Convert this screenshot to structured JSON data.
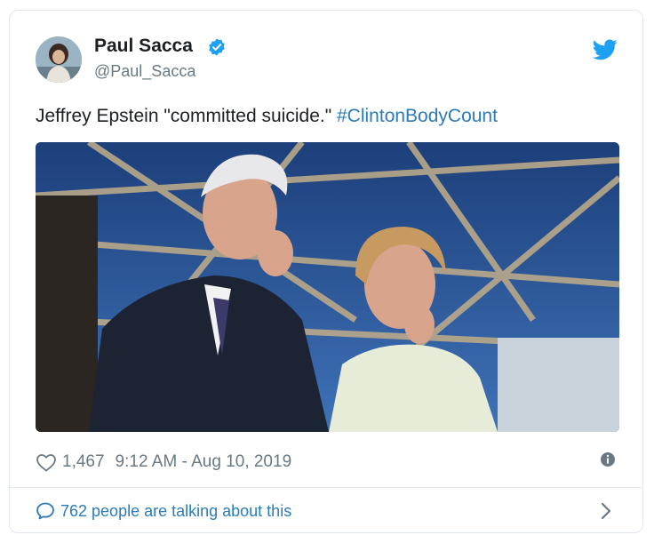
{
  "author": {
    "name": "Paul Sacca",
    "handle": "@Paul_Sacca",
    "verified": true
  },
  "tweet": {
    "text_prefix": "Jeffrey Epstein \"committed suicide.\" ",
    "hashtag": "#ClintonBodyCount"
  },
  "stats": {
    "likes": "1,467",
    "timestamp": "9:12 AM - Aug 10, 2019"
  },
  "conversation": {
    "label": "762 people are talking about this"
  },
  "icons": {
    "verified": "verified-badge-icon",
    "logo": "twitter-bird-icon",
    "like": "heart-icon",
    "info": "info-icon",
    "conversation": "speech-bubble-icon",
    "more": "chevron-right-icon"
  },
  "colors": {
    "link": "#2b7bb9",
    "twitter_blue": "#1da1f2",
    "muted": "#697882",
    "border": "#e1e8ed"
  }
}
